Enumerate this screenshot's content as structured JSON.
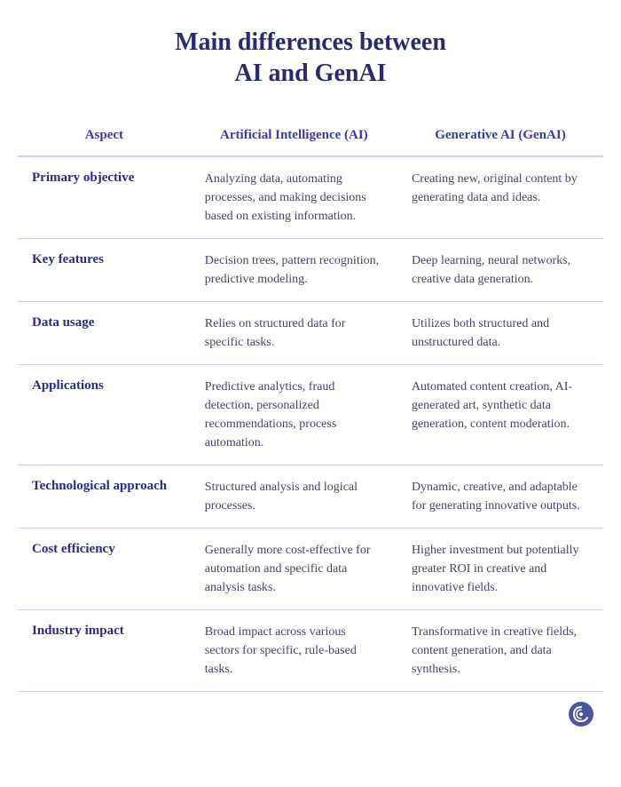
{
  "title": {
    "line1": "Main differences between",
    "line2": "AI and GenAI"
  },
  "table": {
    "headers": {
      "aspect": "Aspect",
      "ai": "Artificial Intelligence (AI)",
      "genai": "Generative AI (GenAI)"
    },
    "rows": [
      {
        "aspect": "Primary objective",
        "ai": "Analyzing data, automating processes, and making decisions based on existing information.",
        "genai": "Creating new, original content by generating data and ideas."
      },
      {
        "aspect": "Key features",
        "ai": "Decision trees, pattern recognition, predictive modeling.",
        "genai": "Deep learning, neural networks, creative data generation."
      },
      {
        "aspect": "Data usage",
        "ai": "Relies on structured data for specific tasks.",
        "genai": "Utilizes both structured and unstructured data."
      },
      {
        "aspect": "Applications",
        "ai": "Predictive analytics, fraud detection, personalized recommendations, process automation.",
        "genai": "Automated content creation, AI-generated art, synthetic data generation, content moderation."
      },
      {
        "aspect": "Technological approach",
        "ai": "Structured analysis and logical processes.",
        "genai": "Dynamic, creative, and adaptable for generating innovative outputs."
      },
      {
        "aspect": "Cost efficiency",
        "ai": "Generally more cost-effective for automation and specific data analysis tasks.",
        "genai": "Higher investment but potentially greater ROI in creative and innovative fields."
      },
      {
        "aspect": "Industry impact",
        "ai": "Broad impact across various sectors for specific, rule-based tasks.",
        "genai": "Transformative in creative fields, content generation, and data synthesis."
      }
    ]
  }
}
